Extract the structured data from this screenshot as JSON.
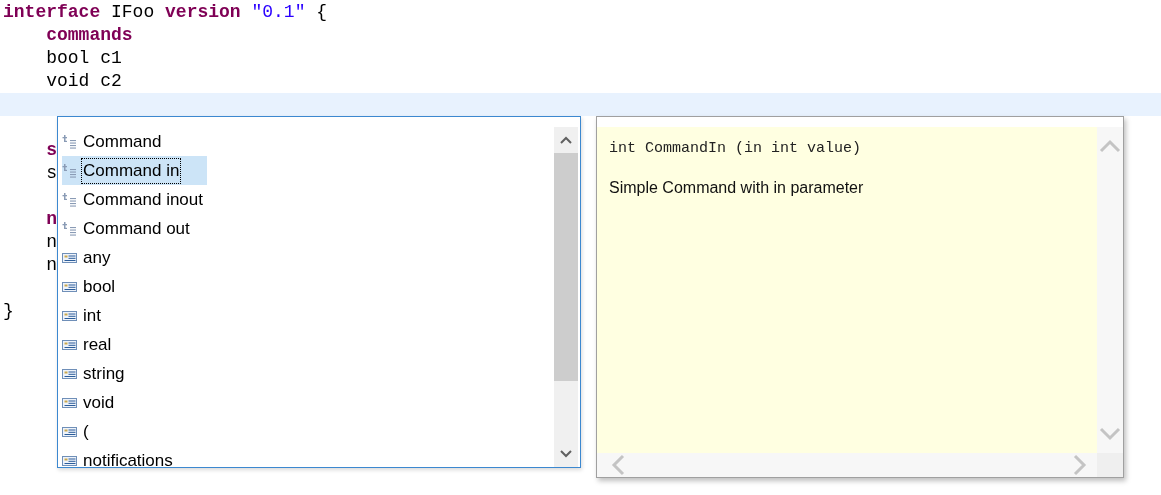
{
  "editor": {
    "lines": [
      {
        "current": false,
        "tokens": [
          {
            "text": "interface",
            "kind": "keyword"
          },
          {
            "text": " IFoo ",
            "kind": "plain"
          },
          {
            "text": "version",
            "kind": "keyword"
          },
          {
            "text": " \"0.1\"",
            "kind": "string"
          },
          {
            "text": " {",
            "kind": "plain"
          }
        ]
      },
      {
        "current": false,
        "tokens": [
          {
            "text": "    commands",
            "kind": "keyword"
          }
        ]
      },
      {
        "current": false,
        "tokens": [
          {
            "text": "    bool c1",
            "kind": "plain"
          }
        ]
      },
      {
        "current": false,
        "tokens": [
          {
            "text": "    void c2",
            "kind": "plain"
          }
        ]
      },
      {
        "current": true
      },
      {
        "current": false
      },
      {
        "current": false,
        "tokens": [
          {
            "text": "    s",
            "kind": "keyword"
          }
        ]
      },
      {
        "current": false,
        "tokens": [
          {
            "text": "    s",
            "kind": "plain"
          }
        ]
      },
      {
        "current": false
      },
      {
        "current": false,
        "tokens": [
          {
            "text": "    n",
            "kind": "keyword"
          }
        ]
      },
      {
        "current": false,
        "tokens": [
          {
            "text": "    n",
            "kind": "plain"
          }
        ]
      },
      {
        "current": false,
        "tokens": [
          {
            "text": "    n",
            "kind": "plain"
          }
        ]
      },
      {
        "current": false
      },
      {
        "current": false,
        "tokens": [
          {
            "text": "}",
            "kind": "plain"
          }
        ]
      }
    ]
  },
  "completion": {
    "items": [
      {
        "label": "Command",
        "kind": "template",
        "selected": false
      },
      {
        "label": "Command in",
        "kind": "template",
        "selected": true
      },
      {
        "label": "Command inout",
        "kind": "template",
        "selected": false
      },
      {
        "label": "Command out",
        "kind": "template",
        "selected": false
      },
      {
        "label": "any",
        "kind": "keyword",
        "selected": false
      },
      {
        "label": "bool",
        "kind": "keyword",
        "selected": false
      },
      {
        "label": "int",
        "kind": "keyword",
        "selected": false
      },
      {
        "label": "real",
        "kind": "keyword",
        "selected": false
      },
      {
        "label": "string",
        "kind": "keyword",
        "selected": false
      },
      {
        "label": "void",
        "kind": "keyword",
        "selected": false
      },
      {
        "label": "(",
        "kind": "keyword",
        "selected": false
      },
      {
        "label": "notifications",
        "kind": "keyword",
        "selected": false
      }
    ]
  },
  "documentation": {
    "signature": "int CommandIn (in int value)",
    "description": "Simple Command with in parameter"
  }
}
